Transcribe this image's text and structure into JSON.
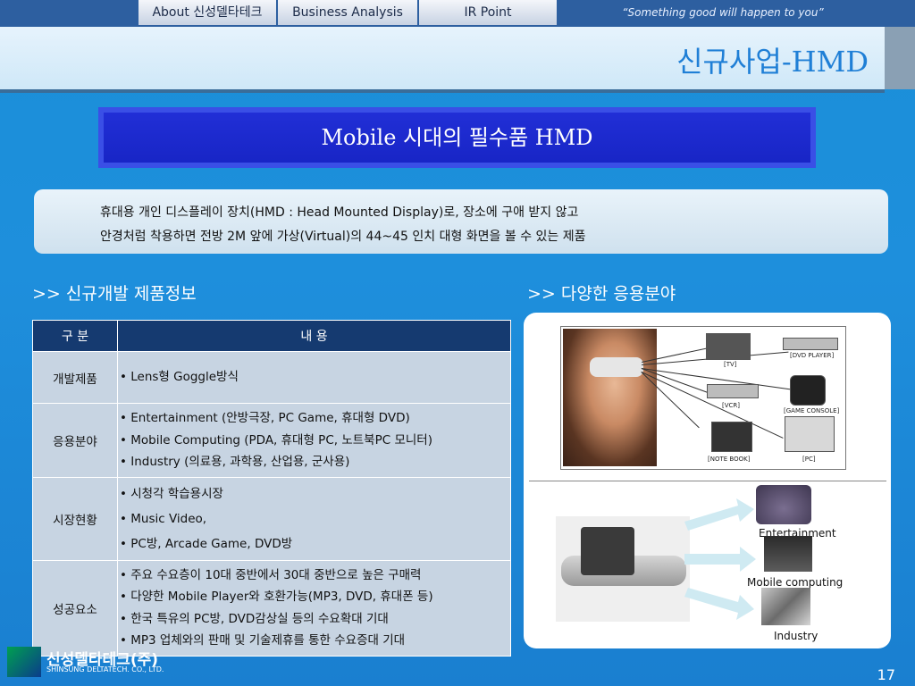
{
  "nav": {
    "tabs": [
      {
        "label": "About 신성델타테크"
      },
      {
        "label": "Business Analysis"
      },
      {
        "label": "IR Point"
      }
    ],
    "slogan": "“Something good will happen to you”"
  },
  "header": {
    "title": "신규사업-HMD"
  },
  "banner": {
    "text": "Mobile 시대의 필수품 HMD"
  },
  "description": {
    "line1": "휴대용 개인 디스플레이 장치(HMD : Head Mounted Display)로, 장소에 구애 받지 않고",
    "line2": "안경처럼 착용하면 전방 2M 앞에 가상(Virtual)의 44~45 인치 대형 화면을 볼 수 있는 제품"
  },
  "sections": {
    "left_title": ">> 신규개발 제품정보",
    "right_title": ">> 다양한 응용분야"
  },
  "table": {
    "headers": [
      "구  분",
      "내  용"
    ],
    "rows": [
      {
        "category": "개발제품",
        "items": [
          "• Lens형 Goggle방식"
        ]
      },
      {
        "category": "응용분야",
        "items": [
          "• Entertainment (안방극장, PC Game, 휴대형 DVD)",
          "• Mobile Computing (PDA, 휴대형 PC, 노트북PC 모니터)",
          "• Industry (의료용, 과학용, 산업용, 군사용)"
        ]
      },
      {
        "category": "시장현황",
        "items": [
          "• 시청각 학습용시장",
          "• Music Video,",
          "• PC방, Arcade Game, DVD방"
        ]
      },
      {
        "category": "성공요소",
        "items": [
          "• 주요 수요층이 10대 중반에서 30대 중반으로 높은 구매력",
          "• 다양한 Mobile Player와 호환가능(MP3, DVD, 휴대폰 등)",
          "• 한국 특유의 PC방, DVD감상실 등의 수요확대 기대",
          "• MP3 업체와의 판매 및 기술제휴를 통한 수요증대 기대"
        ]
      }
    ]
  },
  "devices": {
    "tv": "[TV]",
    "dvd": "[DVD PLAYER]",
    "vcr": "[VCR]",
    "game": "[GAME CONSOLE]",
    "notebook": "[NOTE BOOK]",
    "pc": "[PC]"
  },
  "applications": {
    "entertainment": "Entertainment",
    "mobile": "Mobile computing",
    "industry": "Industry"
  },
  "footer": {
    "company": "신성델타테크(주)",
    "company_en": "SHINSUNG DELTATECH. CO., LTD.",
    "page": "17"
  }
}
